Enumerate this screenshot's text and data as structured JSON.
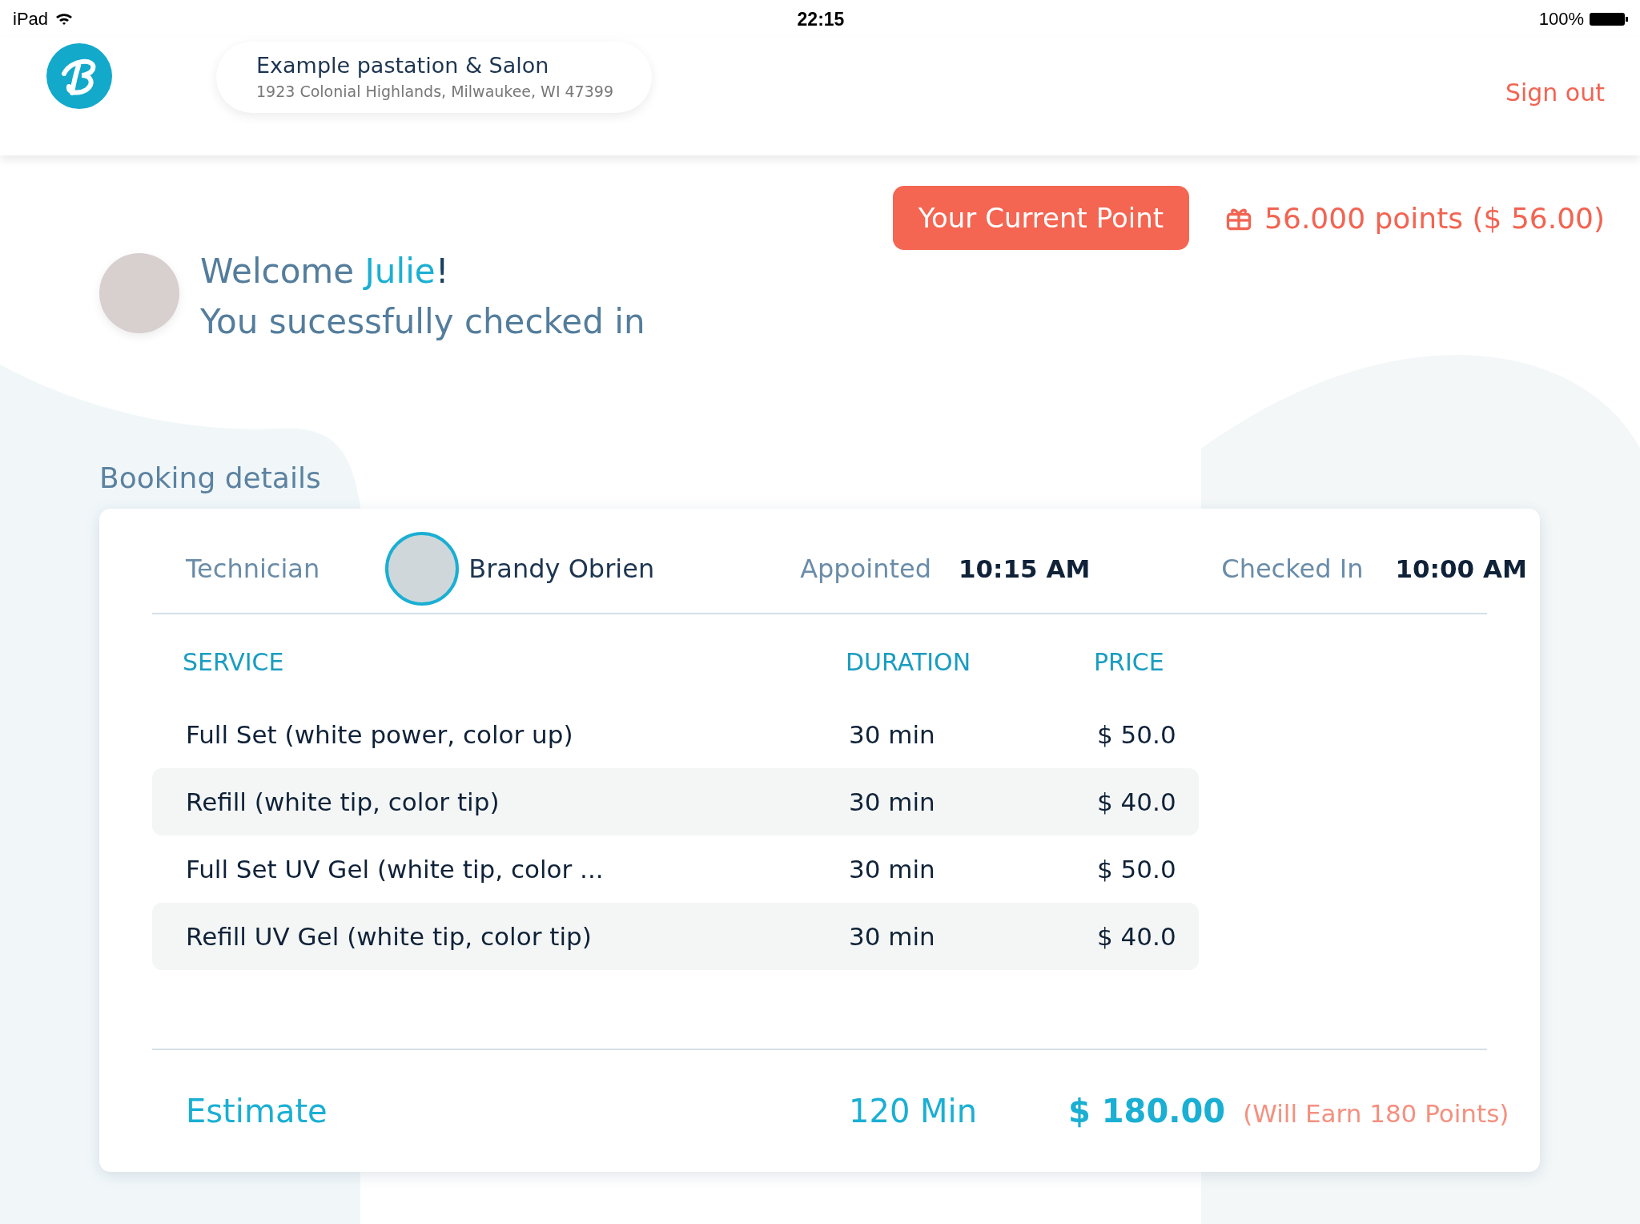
{
  "status_bar": {
    "device": "iPad",
    "time": "22:15",
    "battery": "100%"
  },
  "header": {
    "salon_name": "Example pastation & Salon",
    "salon_address": "1923 Colonial Highlands, Milwaukee, WI 47399",
    "sign_out": "Sign out"
  },
  "points": {
    "button": "Your Current Point",
    "value": "56.000 points ($ 56.00)"
  },
  "welcome": {
    "greeting": "Welcome",
    "name": "Julie",
    "punctuation": "!",
    "message": "You sucessfully checked in"
  },
  "booking": {
    "title": "Booking details",
    "technician_label": "Technician",
    "technician_name": "Brandy Obrien",
    "appointed_label": "Appointed",
    "appointed_time": "10:15 AM",
    "checked_in_label": "Checked In",
    "checked_in_time": "10:00 AM",
    "columns": [
      "SERVICE",
      "DURATION",
      "PRICE"
    ],
    "rows": [
      {
        "service": "Full Set (white power, color up)",
        "duration": "30 min",
        "price": "$ 50.0"
      },
      {
        "service": "Refill (white tip, color tip)",
        "duration": "30 min",
        "price": "$ 40.0"
      },
      {
        "service": "Full Set UV Gel (white tip, color ...",
        "duration": "30 min",
        "price": "$ 50.0"
      },
      {
        "service": "Refill UV Gel (white tip, color tip)",
        "duration": "30 min",
        "price": "$ 40.0"
      }
    ],
    "estimate": {
      "label": "Estimate",
      "duration": "120 Min",
      "price": "$ 180.00",
      "note": "(Will Earn 180 Points)"
    }
  }
}
